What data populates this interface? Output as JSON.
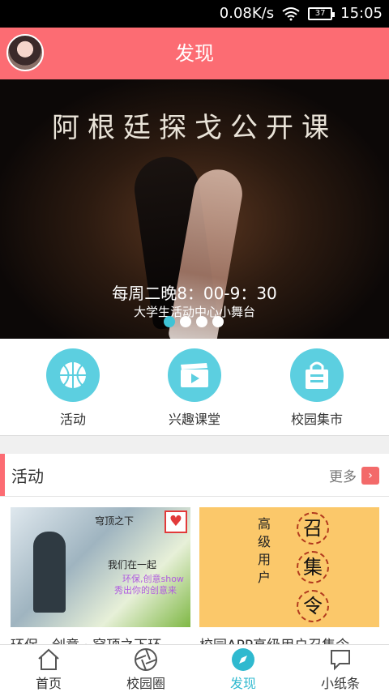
{
  "status_bar": {
    "speed": "0.08K/s",
    "battery": "37",
    "time": "15:05"
  },
  "header": {
    "title": "发现"
  },
  "banner": {
    "title": "阿根廷探戈公开课",
    "line1": "每周二晚8：00-9：30",
    "line2": "大学生活动中心小舞台",
    "dots": [
      true,
      false,
      false,
      false
    ]
  },
  "quick_links": [
    {
      "label": "活动",
      "icon": "basketball-icon"
    },
    {
      "label": "兴趣课堂",
      "icon": "clapperboard-icon"
    },
    {
      "label": "校园集市",
      "icon": "shopping-bag-icon"
    }
  ],
  "section": {
    "title": "活动",
    "more": "更多",
    "cards": [
      {
        "caption": "环保、创意 · 穹顶之下环",
        "art": {
          "t1": "穹顶之下",
          "t2": "我们在一起",
          "t3": "环保,创意show",
          "t4": "秀出你的创意来"
        }
      },
      {
        "caption": "校园APP高级用户召集令",
        "art": {
          "vertical": "高级用户",
          "chars": [
            "召",
            "集",
            "令"
          ]
        }
      }
    ]
  },
  "tabs": [
    {
      "label": "首页",
      "icon": "home-icon",
      "active": false
    },
    {
      "label": "校园圈",
      "icon": "aperture-icon",
      "active": false
    },
    {
      "label": "发现",
      "icon": "compass-icon",
      "active": true
    },
    {
      "label": "小纸条",
      "icon": "chat-bubble-icon",
      "active": false
    }
  ],
  "colors": {
    "header": "#fc6c73",
    "accent": "#5ccfe0",
    "active_tab": "#2fb9cf"
  }
}
